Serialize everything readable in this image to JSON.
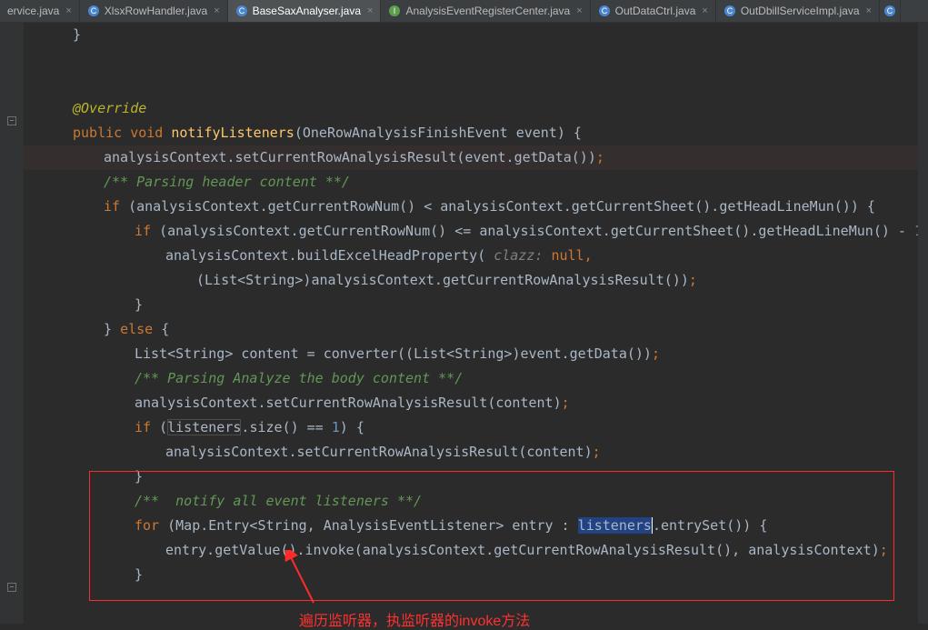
{
  "tabs": [
    {
      "label": "ervice.java",
      "active": false,
      "icon": "java-class"
    },
    {
      "label": "XlsxRowHandler.java",
      "active": false,
      "icon": "java-class",
      "closable": true
    },
    {
      "label": "BaseSaxAnalyser.java",
      "active": true,
      "icon": "java-class",
      "closable": true
    },
    {
      "label": "AnalysisEventRegisterCenter.java",
      "active": false,
      "icon": "java-interface",
      "closable": true
    },
    {
      "label": "OutDataCtrl.java",
      "active": false,
      "icon": "java-class",
      "closable": true
    },
    {
      "label": "OutDbillServiceImpl.java",
      "active": false,
      "icon": "java-class",
      "closable": true
    }
  ],
  "code": {
    "t": {
      "override": "@Override",
      "public": "public",
      "void": "void",
      "notifyListeners": "notifyListeners",
      "oneRowEvent": "OneRowAnalysisFinishEvent",
      "event": "event",
      "analysisContext": "analysisContext",
      "setCurrentRowAnalysisResult": "setCurrentRowAnalysisResult",
      "getData": "getData",
      "parseHeader": "/** Parsing header content **/",
      "if": "if",
      "getCurrentRowNum": "getCurrentRowNum",
      "getCurrentSheet": "getCurrentSheet",
      "getHeadLineMun": "getHeadLineMun",
      "buildExcelHeadProperty": "buildExcelHeadProperty",
      "clazzLabel": "clazz:",
      "null": "null",
      "ListString": "List<String>",
      "getCurrentRowAnalysisResult": "getCurrentRowAnalysisResult",
      "else": "else",
      "content": "content",
      "converter": "converter",
      "parseBody": "/** Parsing Analyze the body content **/",
      "listeners": "listeners",
      "size": "size",
      "one": "1",
      "notifyAll": "/**  notify all event listeners **/",
      "for": "for",
      "MapEntry": "Map.Entry<String, AnalysisEventListener>",
      "entry": "entry",
      "entrySet": "entrySet",
      "getValue": "getValue",
      "invoke": "invoke"
    }
  },
  "annotation": "遍历监听器，执监听器的invoke方法"
}
